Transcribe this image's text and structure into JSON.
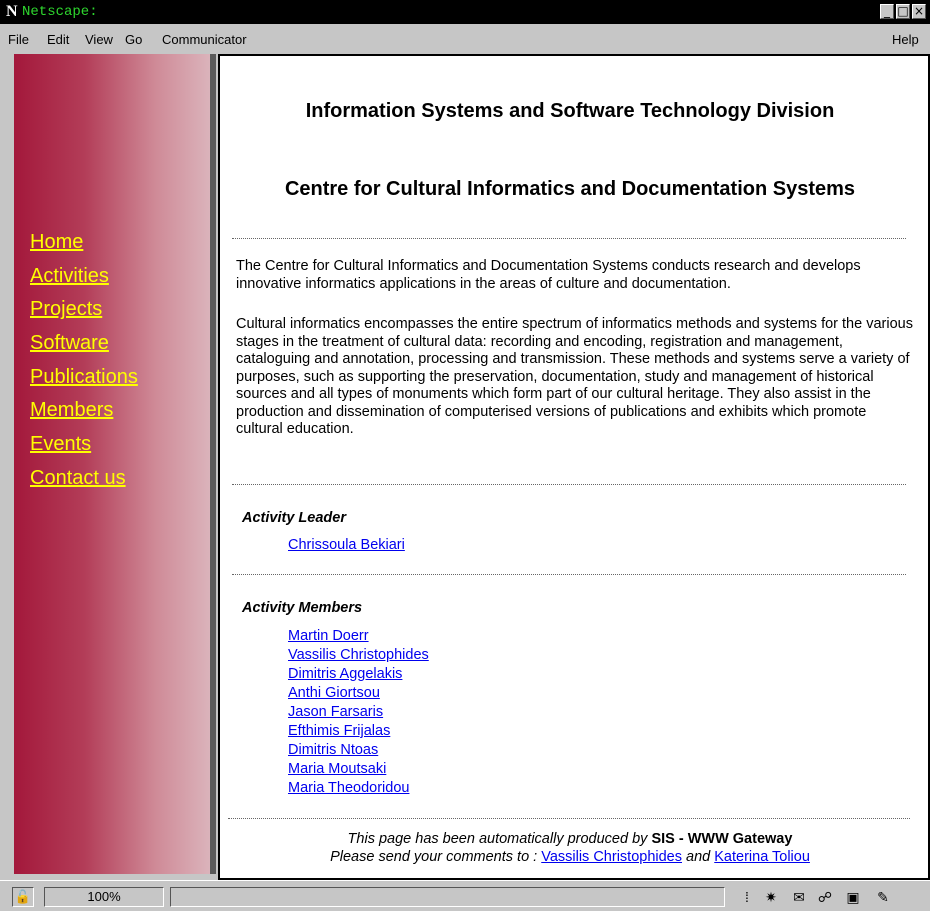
{
  "window": {
    "title": "Netscape:",
    "logo": "N",
    "buttons": [
      "_",
      "□",
      "×"
    ]
  },
  "menu": {
    "items": [
      "File",
      "Edit",
      "View",
      "Go",
      "Communicator"
    ],
    "help": "Help"
  },
  "nav": [
    "Home",
    "Activities",
    "Projects",
    "Software",
    "Publications",
    "Members",
    "Events",
    "Contact us"
  ],
  "content": {
    "division": "Information Systems and Software Technology Division",
    "centre": "Centre for Cultural Informatics and Documentation Systems",
    "intro": "The Centre for Cultural Informatics and Documentation Systems conducts research and develops innovative informatics applications in the areas of culture and documentation.",
    "description": "Cultural informatics encompasses the entire spectrum of informatics methods and systems for the various stages in the treatment of cultural data: recording and encoding, registration and management, cataloguing and annotation, processing and transmission. These methods and systems serve a variety of purposes, such as supporting the preservation, documentation, study and management of historical sources and all types of monuments which form part of our cultural heritage. They also assist in the production and dissemination of computerised versions of publications and exhibits which promote cultural education.",
    "leader_label": "Activity Leader",
    "leader": "Chrissoula Bekiari",
    "members_label": "Activity Members",
    "members": [
      "Martin Doerr",
      "Vassilis Christophides",
      "Dimitris Aggelakis",
      "Anthi Giortsou",
      "Jason Farsaris",
      "Efthimis Frijalas",
      "Dimitris Ntoas",
      "Maria Moutsaki",
      "Maria Theodoridou"
    ]
  },
  "footer": {
    "line1_prefix": "This page has been automatically produced by ",
    "line1_bold": "SIS - WWW Gateway",
    "line2_prefix": "Please send your comments to : ",
    "contact1": "Vassilis Christophides",
    "and": " and ",
    "contact2": "Katerina Toliou"
  },
  "status": {
    "zoom": "100%",
    "icons": [
      "grid-icon",
      "navigator-icon",
      "mail-icon",
      "newsgroups-icon",
      "address-book-icon",
      "composer-icon"
    ]
  }
}
